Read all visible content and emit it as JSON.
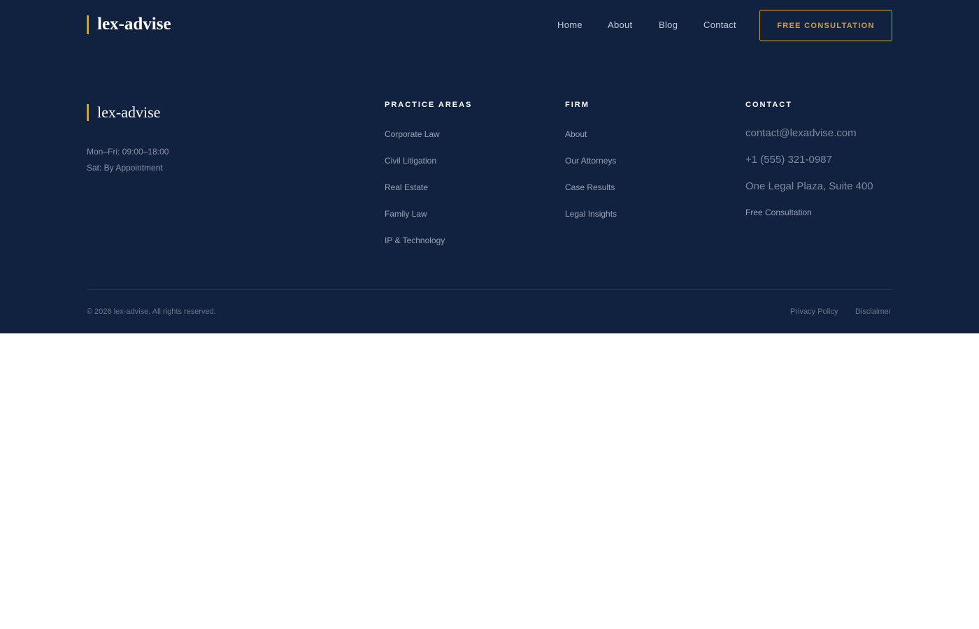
{
  "header": {
    "logo": "lex-advise",
    "nav": [
      "Home",
      "About",
      "Blog",
      "Contact"
    ],
    "cta": "FREE CONSULTATION"
  },
  "footer": {
    "brand": "lex-advise",
    "hours": [
      "Mon–Fri: 09:00–18:00",
      "Sat: By Appointment"
    ],
    "practice_areas": {
      "title": "PRACTICE AREAS",
      "items": [
        "Corporate Law",
        "Civil Litigation",
        "Real Estate",
        "Family Law",
        "IP & Technology"
      ]
    },
    "firm": {
      "title": "FIRM",
      "items": [
        "About",
        "Our Attorneys",
        "Case Results",
        "Legal Insights"
      ]
    },
    "contact": {
      "title": "CONTACT",
      "email": "contact@lexadvise.com",
      "phone": "+1 (555) 321-0987",
      "address": "One Legal Plaza, Suite 400",
      "link": "Free Consultation"
    },
    "copyright": "© 2026 lex-advise. All rights reserved.",
    "legal": [
      "Privacy Policy",
      "Disclaimer"
    ]
  },
  "colors": {
    "background": "#112241",
    "accent": "#c9a14a",
    "page": "#ffffff"
  }
}
